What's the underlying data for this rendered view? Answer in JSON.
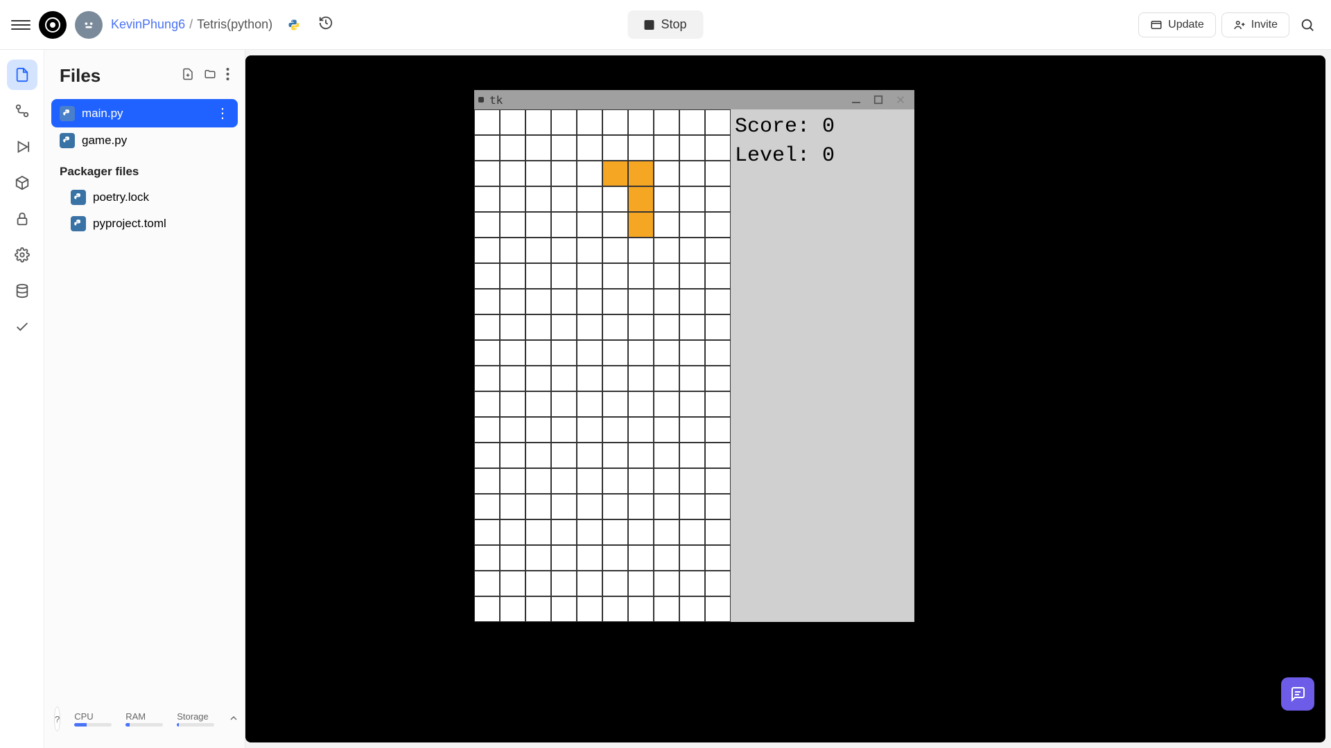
{
  "header": {
    "breadcrumb_user": "KevinPhung6",
    "breadcrumb_repo": "Tetris(python)",
    "stop_label": "Stop",
    "update_label": "Update",
    "invite_label": "Invite",
    "language": "python"
  },
  "sidebar": {
    "title": "Files",
    "files": [
      {
        "name": "main.py",
        "icon": "python"
      },
      {
        "name": "game.py",
        "icon": "python"
      }
    ],
    "section": "Packager files",
    "package_files": [
      {
        "name": "poetry.lock",
        "icon": "python"
      },
      {
        "name": "pyproject.toml",
        "icon": "python"
      }
    ],
    "stats": {
      "cpu_label": "CPU",
      "cpu_pct": 32,
      "ram_label": "RAM",
      "ram_pct": 10,
      "storage_label": "Storage",
      "storage_pct": 5
    }
  },
  "output": {
    "window_title": "tk",
    "score_label": "Score:",
    "score_value": "0",
    "level_label": "Level:",
    "level_value": "0",
    "grid_cols": 10,
    "grid_rows": 20,
    "piece_color": "#f5a623",
    "piece_cells": [
      {
        "row": 2,
        "col": 5
      },
      {
        "row": 2,
        "col": 6
      },
      {
        "row": 3,
        "col": 6
      },
      {
        "row": 4,
        "col": 6
      }
    ]
  }
}
